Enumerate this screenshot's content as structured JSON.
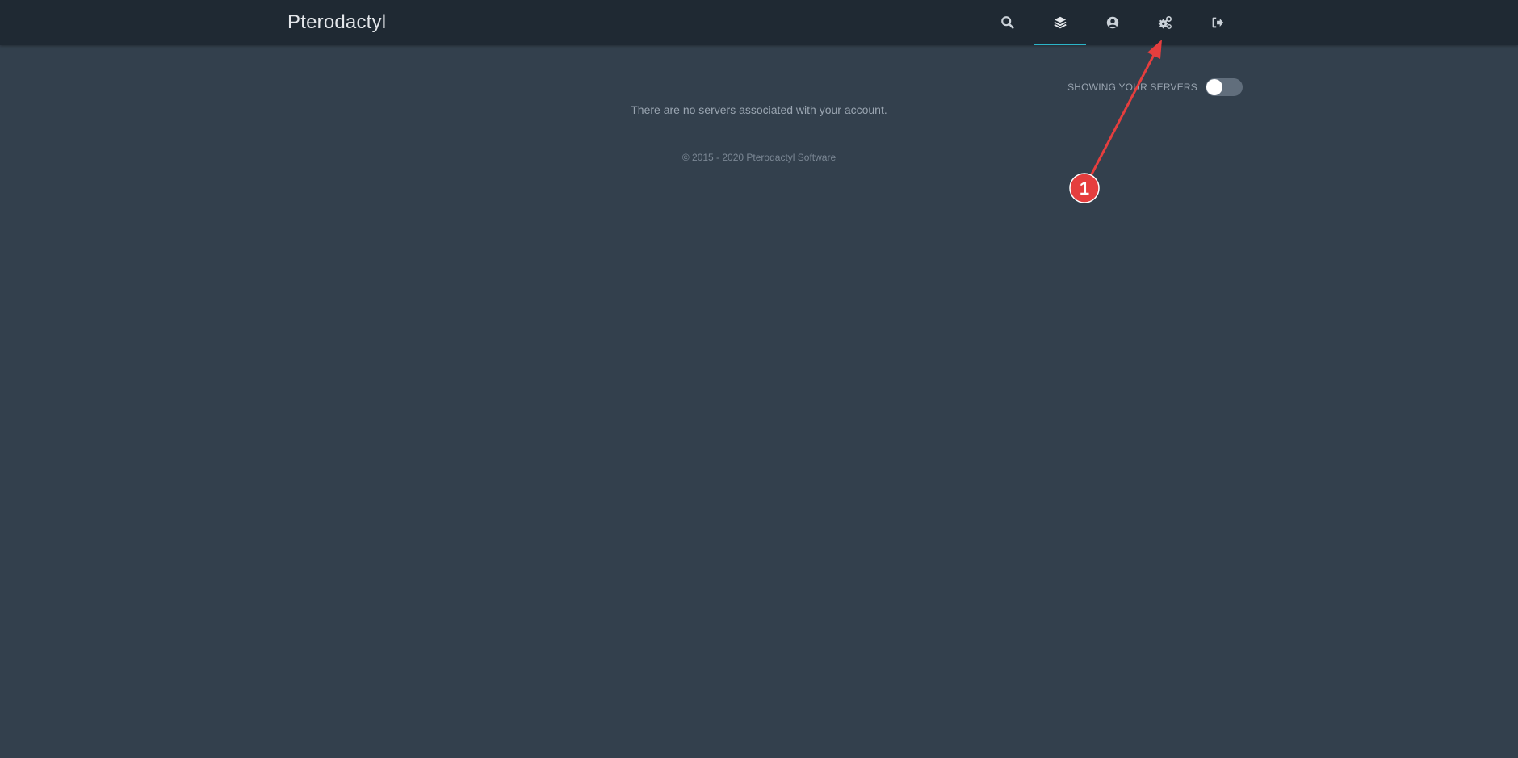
{
  "header": {
    "brand": "Pterodactyl",
    "nav_icons": [
      "search-icon",
      "layers-icon",
      "user-circle-icon",
      "cogs-icon",
      "sign-out-icon"
    ],
    "active_index": 1,
    "accent_color": "#2bb5c8"
  },
  "toolbar": {
    "toggle_label": "Showing your servers",
    "toggle_on": false
  },
  "main": {
    "empty_message": "There are no servers associated with your account."
  },
  "footer": {
    "copyright": "© 2015 - 2020 Pterodactyl Software"
  },
  "annotation": {
    "badge_number": "1",
    "color": "#e53e3e"
  }
}
